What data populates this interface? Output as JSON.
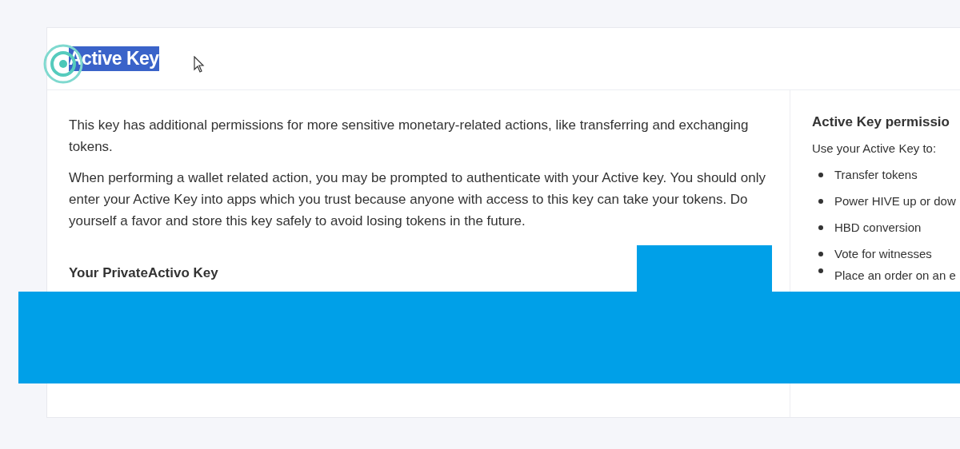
{
  "header": {
    "title": "Active Key",
    "title_highlighted": true
  },
  "main": {
    "paragraphs": [
      "This key has additional permissions for more sensitive monetary-related actions, like transferring and exchanging tokens.",
      "When performing a wallet related action, you may be prompted to authenticate with your Active key. You should only enter your Active Key into apps which you trust because anyone with access to this key can take your tokens. Do yourself a favor and store this key safely to avoid losing tokens in the future."
    ],
    "key_heading": "Your PrivateActivo Key"
  },
  "sidebar": {
    "title": "Active Key permissio",
    "intro": "Use your Active Key to:",
    "items": [
      "Transfer tokens",
      "Power HIVE up or dow",
      "HBD conversion",
      "Vote for witnesses",
      "Place an order on an e"
    ]
  }
}
